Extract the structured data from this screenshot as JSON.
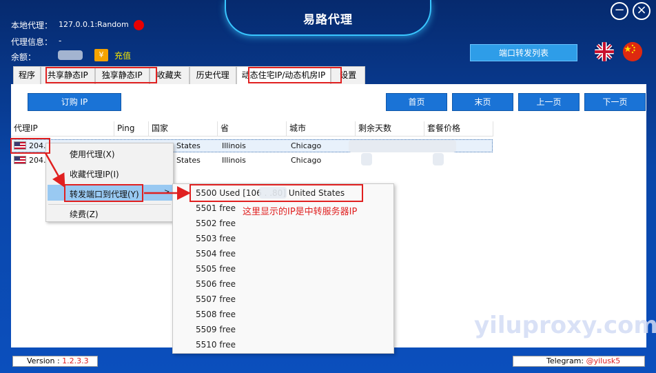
{
  "app": {
    "title": "易路代理"
  },
  "window": {
    "minimize_glyph": "−",
    "close_glyph": "×"
  },
  "info": {
    "local_proxy_label": "本地代理：",
    "local_proxy_value": "127.0.0.1:Random",
    "proxy_info_label": "代理信息：",
    "proxy_info_value": "-",
    "balance_label": "余额：",
    "currency_symbol": "¥",
    "recharge_label": "充值"
  },
  "header": {
    "port_forward_list_label": "端口转发列表"
  },
  "tabs": [
    {
      "label": "程序"
    },
    {
      "label": "共享静态IP"
    },
    {
      "label": "独享静态IP"
    },
    {
      "label": "收藏夹"
    },
    {
      "label": "历史代理"
    },
    {
      "label": "动态住宅IP/动态机房IP"
    },
    {
      "label": "设置"
    }
  ],
  "toolbar": {
    "buy_ip_label": "订购 IP",
    "first_page_label": "首页",
    "last_page_label": "末页",
    "prev_page_label": "上一页",
    "next_page_label": "下一页"
  },
  "table": {
    "columns": [
      "代理IP",
      "Ping",
      "国家",
      "省",
      "城市",
      "剩余天数",
      "套餐价格"
    ],
    "rows": [
      {
        "ip": "204.",
        "country": "States",
        "province": "Illinois",
        "city": "Chicago"
      },
      {
        "ip": "204.",
        "country": "States",
        "province": "Illinois",
        "city": "Chicago"
      }
    ]
  },
  "context_menu": {
    "items": [
      {
        "label": "使用代理(X)"
      },
      {
        "label": "收藏代理IP(I)"
      },
      {
        "label": "转发端口到代理(Y)"
      },
      {
        "label": "续费(Z)"
      }
    ],
    "submenu_arrow": ">"
  },
  "submenu": {
    "items": [
      "5500 Used [106   .   .80] United States",
      "5501 free",
      "5502 free",
      "5503 free",
      "5504 free",
      "5505 free",
      "5506 free",
      "5507 free",
      "5508 free",
      "5509 free",
      "5510 free"
    ]
  },
  "annotation": {
    "text": "这里显示的IP是中转服务器IP"
  },
  "watermark": {
    "text": "yiluproxy.com"
  },
  "footer": {
    "version_label": "Version :",
    "version_value": "1.2.3.3",
    "telegram_label": "Telegram:",
    "telegram_value": "@yilusk5"
  },
  "colors": {
    "accent_blue": "#1a73d6",
    "highlight_red": "#e02020",
    "recharge_yellow": "#f5e600"
  }
}
